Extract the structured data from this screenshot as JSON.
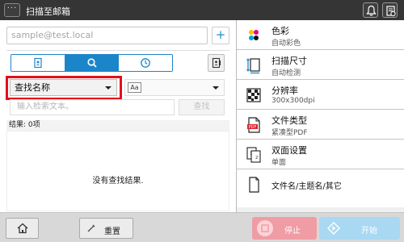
{
  "topbar": {
    "menu_label": "···",
    "title": "扫描至邮箱",
    "icons": [
      "bell-icon",
      "device-status-icon"
    ]
  },
  "destination": {
    "placeholder": "sample@test.local",
    "add_label": "+"
  },
  "tabs": [
    {
      "id": "address-book",
      "icon": "address-book-icon",
      "active": false
    },
    {
      "id": "search",
      "icon": "search-icon",
      "active": true
    },
    {
      "id": "history",
      "icon": "clock-icon",
      "active": false
    }
  ],
  "search": {
    "field_selected": "查找名称",
    "case_icon_label": "Aa",
    "input_placeholder": "输入检索文本。",
    "button_label": "查找"
  },
  "results": {
    "header": "结果: 0项",
    "empty_message": "没有查找结果."
  },
  "settings": [
    {
      "id": "color",
      "title": "色彩",
      "value": "自动彩色",
      "icon": "color-icon"
    },
    {
      "id": "scan-size",
      "title": "扫描尺寸",
      "value": "自动检测",
      "icon": "scan-size-icon"
    },
    {
      "id": "resolution",
      "title": "分辨率",
      "value": "300x300dpi",
      "icon": "resolution-icon"
    },
    {
      "id": "file-type",
      "title": "文件类型",
      "value": "紧凑型PDF",
      "icon": "pdf-file-icon"
    },
    {
      "id": "duplex",
      "title": "双面设置",
      "value": "单面",
      "icon": "duplex-icon"
    },
    {
      "id": "file-name",
      "title": "文件名/主题名/其它",
      "value": "",
      "icon": "document-icon"
    }
  ],
  "bottombar": {
    "reset_label": "重置",
    "stop_label": "停止",
    "start_label": "开始"
  },
  "colors": {
    "accent": "#1a86c9",
    "highlight": "#e20f1a",
    "stop": "#ef9ca5",
    "start": "#a9d8f2"
  }
}
